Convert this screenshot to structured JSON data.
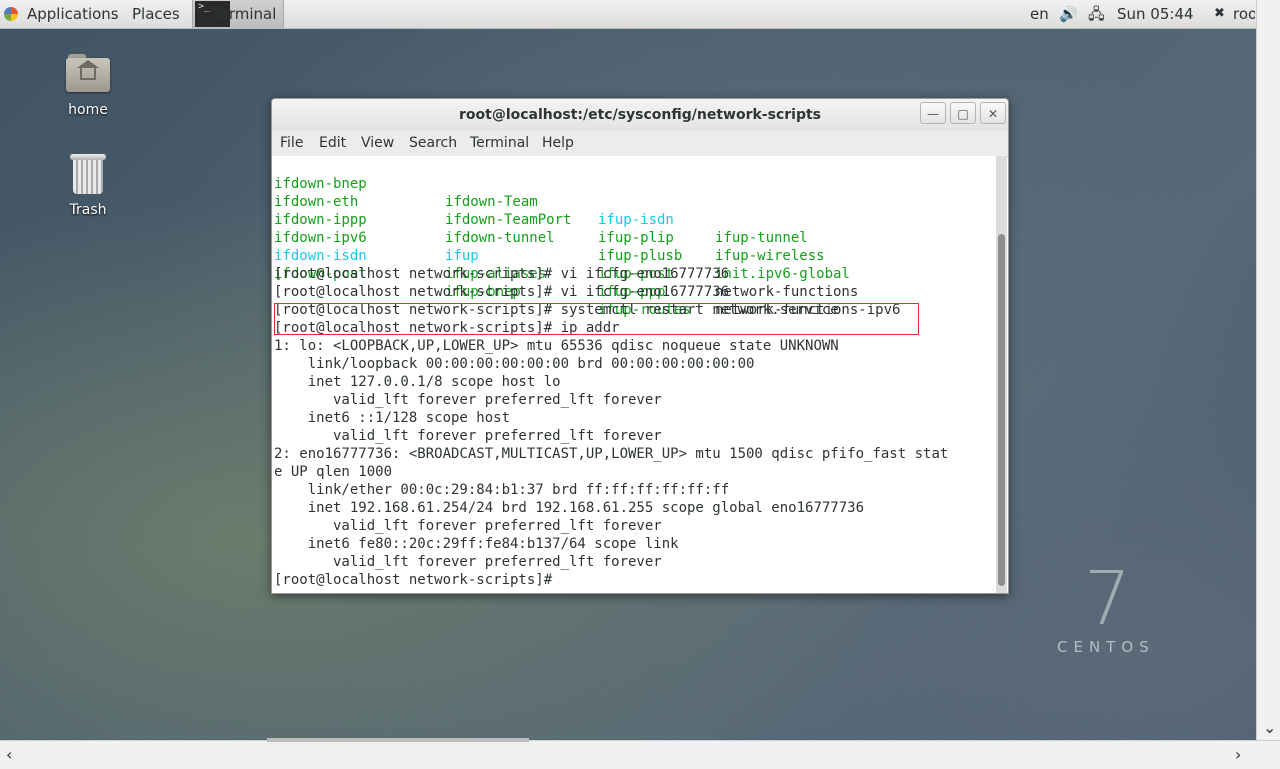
{
  "topbar": {
    "applications": "Applications",
    "places": "Places",
    "task": "Terminal",
    "lang": "en",
    "clock": "Sun 05:44",
    "user": "roo"
  },
  "desktop": {
    "home": "home",
    "trash": "Trash"
  },
  "window": {
    "title": "root@localhost:/etc/sysconfig/network-scripts",
    "menu": [
      "File",
      "Edit",
      "View",
      "Search",
      "Terminal",
      "Help"
    ]
  },
  "terminal": {
    "listing": [
      [
        "ifdown-bnep",
        "ifdown-Team",
        "ifup-isdn",
        "ifup-tunnel"
      ],
      [
        "ifdown-eth",
        "ifdown-TeamPort",
        "ifup-plip",
        "ifup-wireless"
      ],
      [
        "ifdown-ippp",
        "ifdown-tunnel",
        "ifup-plusb",
        "init.ipv6-global"
      ],
      [
        "ifdown-ipv6",
        "ifup",
        "ifup-post",
        "network-functions"
      ],
      [
        "ifdown-isdn",
        "ifup-aliases",
        "ifup-ppp",
        "network-functions-ipv6"
      ],
      [
        "ifdown-post",
        "ifup-bnep",
        "ifup-routes",
        ""
      ]
    ],
    "lines": [
      "[root@localhost network-scripts]# vi ifcfg-eno16777736",
      "[root@localhost network-scripts]# vi ifcfg-eno16777736",
      "[root@localhost network-scripts]# systemctl restart network.service",
      "[root@localhost network-scripts]# ip addr",
      "1: lo: <LOOPBACK,UP,LOWER_UP> mtu 65536 qdisc noqueue state UNKNOWN",
      "    link/loopback 00:00:00:00:00:00 brd 00:00:00:00:00:00",
      "    inet 127.0.0.1/8 scope host lo",
      "       valid_lft forever preferred_lft forever",
      "    inet6 ::1/128 scope host",
      "       valid_lft forever preferred_lft forever",
      "2: eno16777736: <BROADCAST,MULTICAST,UP,LOWER_UP> mtu 1500 qdisc pfifo_fast stat",
      "e UP qlen 1000",
      "    link/ether 00:0c:29:84:b1:37 brd ff:ff:ff:ff:ff:ff",
      "    inet 192.168.61.254/24 brd 192.168.61.255 scope global eno16777736",
      "       valid_lft forever preferred_lft forever",
      "    inet6 fe80::20c:29ff:fe84:b137/64 scope link",
      "       valid_lft forever preferred_lft forever",
      "[root@localhost network-scripts]# "
    ]
  },
  "logo": {
    "number": "7",
    "name": "CENTOS"
  }
}
